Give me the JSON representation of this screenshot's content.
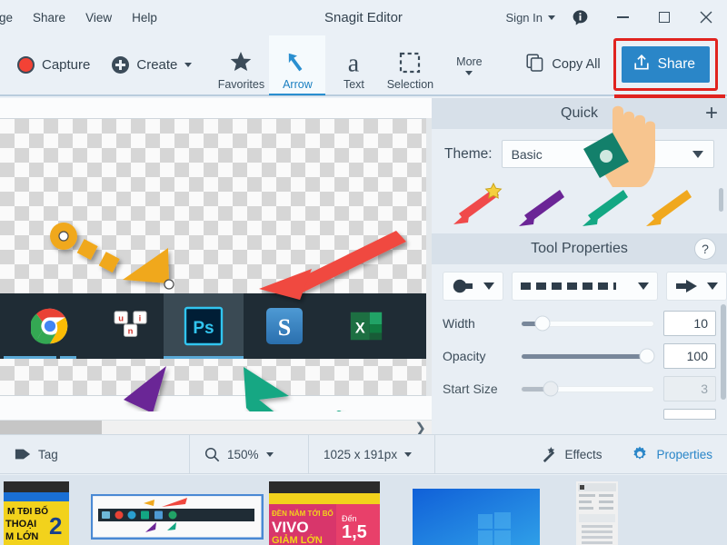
{
  "window": {
    "title": "Snagit Editor",
    "menus": [
      {
        "label": "ge",
        "name": "menu-image-truncated"
      },
      {
        "label": "Share",
        "name": "menu-share"
      },
      {
        "label": "View",
        "name": "menu-view"
      },
      {
        "label": "Help",
        "name": "menu-help"
      }
    ],
    "sign_in": "Sign In",
    "info_icon": "info-icon",
    "minimize": "minimize-button",
    "maximize": "maximize-button",
    "close": "close-button"
  },
  "toolbar": {
    "capture_label": "Capture",
    "create_label": "Create",
    "tools": [
      {
        "label": "Favorites",
        "icon": "star-icon",
        "active": false
      },
      {
        "label": "Arrow",
        "icon": "arrow-icon",
        "active": true
      },
      {
        "label": "Text",
        "icon": "text-a-icon",
        "active": false
      },
      {
        "label": "Selection",
        "icon": "selection-dashed-icon",
        "active": false
      }
    ],
    "more_label": "More",
    "copy_all_label": "Copy All",
    "share_label": "Share",
    "share_bg": "#2a86c8",
    "highlight_color": "#e0231f"
  },
  "quick_panel": {
    "title": "Quick",
    "add_label": "+",
    "theme_label": "Theme:",
    "theme_value": "Basic",
    "presets": [
      {
        "name": "arrow-preset-red",
        "color": "#f04a4a",
        "favorite": true
      },
      {
        "name": "arrow-preset-purple",
        "color": "#6b2596",
        "favorite": false
      },
      {
        "name": "arrow-preset-teal",
        "color": "#13a783",
        "favorite": false
      },
      {
        "name": "arrow-preset-orange",
        "color": "#f0a81e",
        "favorite": false
      }
    ]
  },
  "tool_properties": {
    "title": "Tool Properties",
    "help_label": "?",
    "start_cap": "circle-tail-cap",
    "line_style": "dashed-line",
    "end_cap": "arrow-end-cap",
    "sliders": [
      {
        "label": "Width",
        "value": "10",
        "pct": 16,
        "disabled": false
      },
      {
        "label": "Opacity",
        "value": "100",
        "pct": 95,
        "disabled": false
      },
      {
        "label": "Start Size",
        "value": "3",
        "pct": 22,
        "disabled": true
      }
    ]
  },
  "status_bar": {
    "tag_label": "Tag",
    "zoom_value": "150%",
    "dimensions": "1025 x 191px",
    "effects_label": "Effects",
    "properties_label": "Properties",
    "accent": "#2a86c8"
  },
  "canvas": {
    "taskbar_apps": [
      {
        "name": "chrome-icon",
        "selected": false
      },
      {
        "name": "unikey-icon",
        "selected": false
      },
      {
        "name": "photoshop-icon",
        "selected": true
      },
      {
        "name": "snagit-icon",
        "selected": false
      },
      {
        "name": "excel-icon",
        "selected": false
      }
    ],
    "annotations": [
      {
        "name": "orange-dashed-arrow",
        "color": "#f0a81e"
      },
      {
        "name": "red-arrow",
        "color": "#f0483f"
      },
      {
        "name": "purple-dashed-arrow",
        "color": "#6b2596"
      },
      {
        "name": "teal-dashed-arrow",
        "color": "#13a783"
      }
    ]
  },
  "filmstrip": {
    "thumbnails": [
      {
        "name": "thumbnail-banner-yellow"
      },
      {
        "name": "thumbnail-taskbar-capture"
      },
      {
        "name": "thumbnail-vivo-promo"
      },
      {
        "name": "thumbnail-windows-desktop"
      },
      {
        "name": "thumbnail-settings-panel"
      }
    ]
  },
  "cursor": {
    "name": "hand-pointer-cursor",
    "skin": "#f7c58f",
    "sleeve": "#13806b"
  }
}
